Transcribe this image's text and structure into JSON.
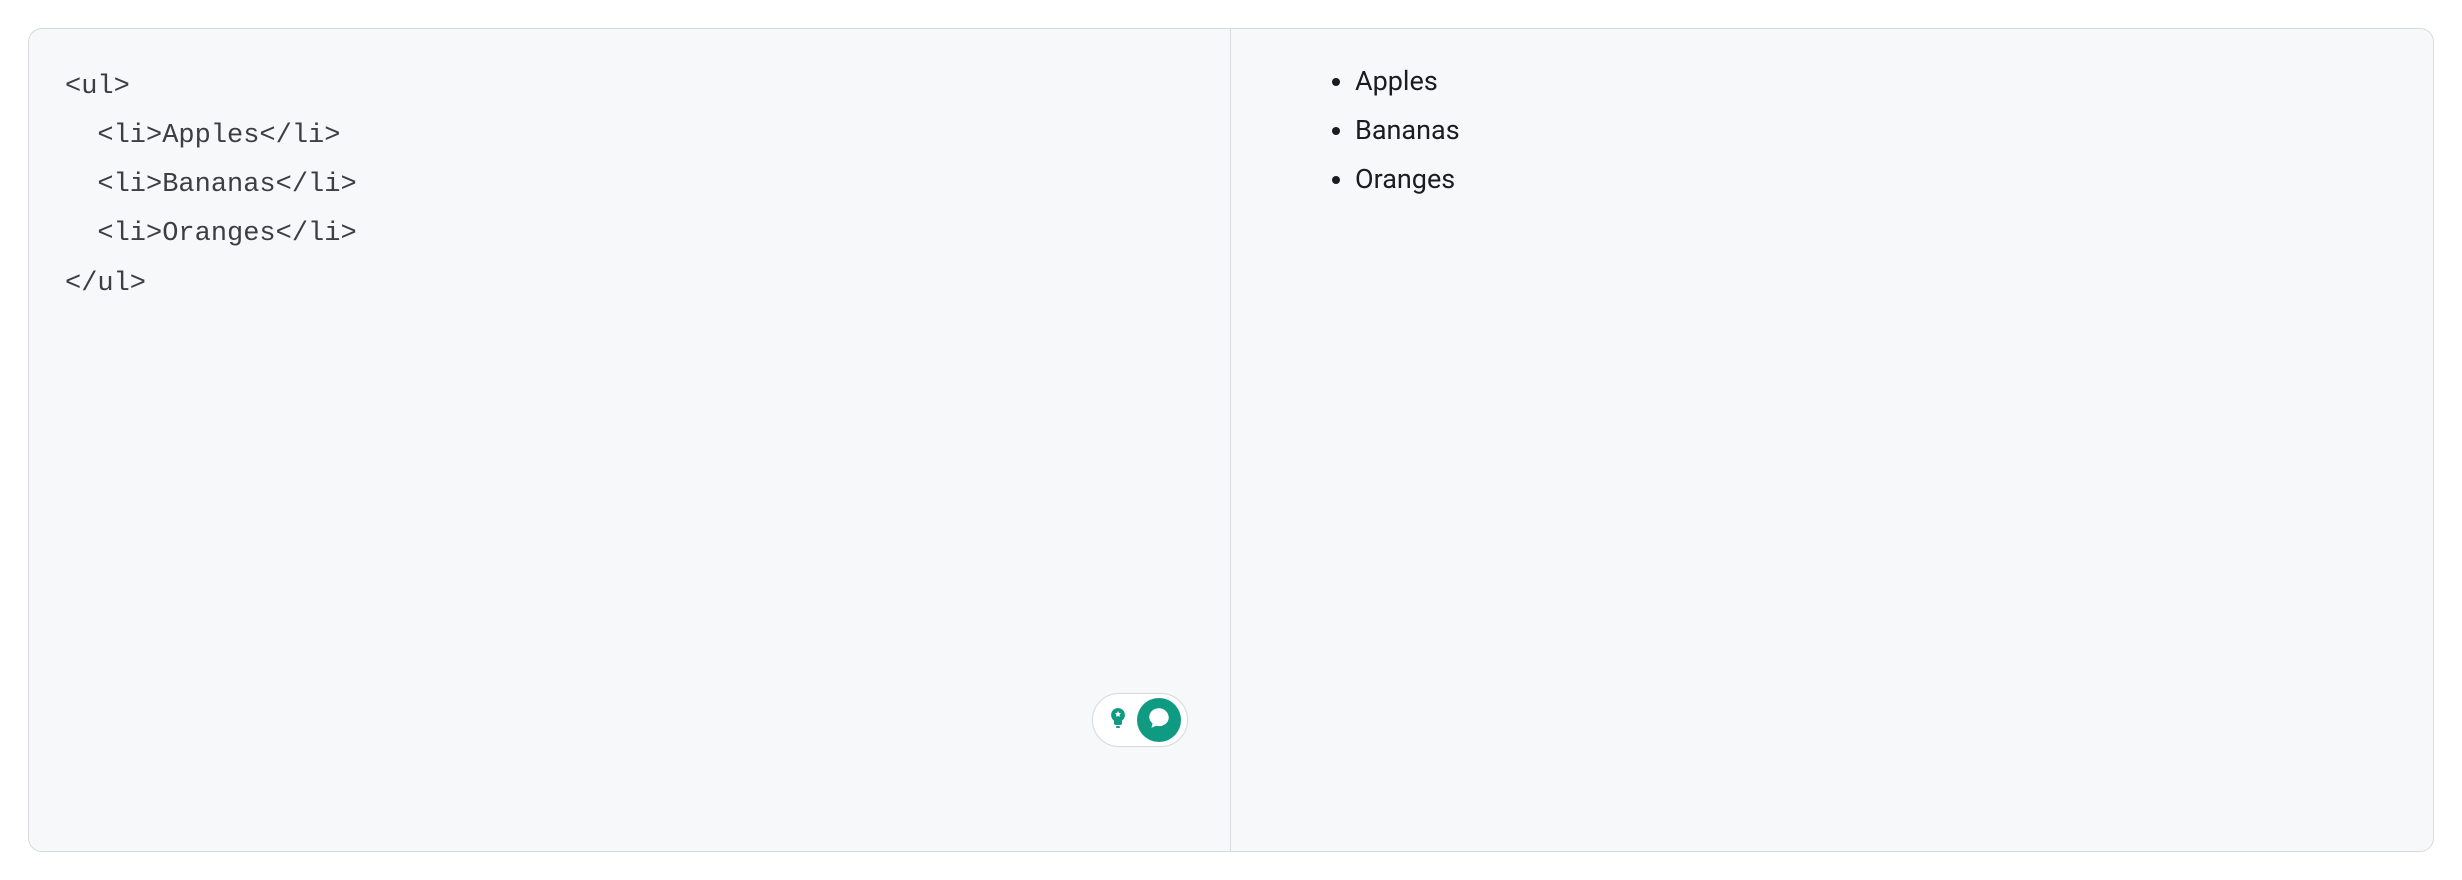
{
  "code": {
    "line1": "<ul>",
    "line2": "  <li>Apples</li>",
    "line3": "  <li>Bananas</li>",
    "line4": "  <li>Oranges</li>",
    "line5": "</ul>"
  },
  "preview": {
    "items": [
      "Apples",
      "Bananas",
      "Oranges"
    ]
  },
  "colors": {
    "accent": "#0f9b82"
  }
}
